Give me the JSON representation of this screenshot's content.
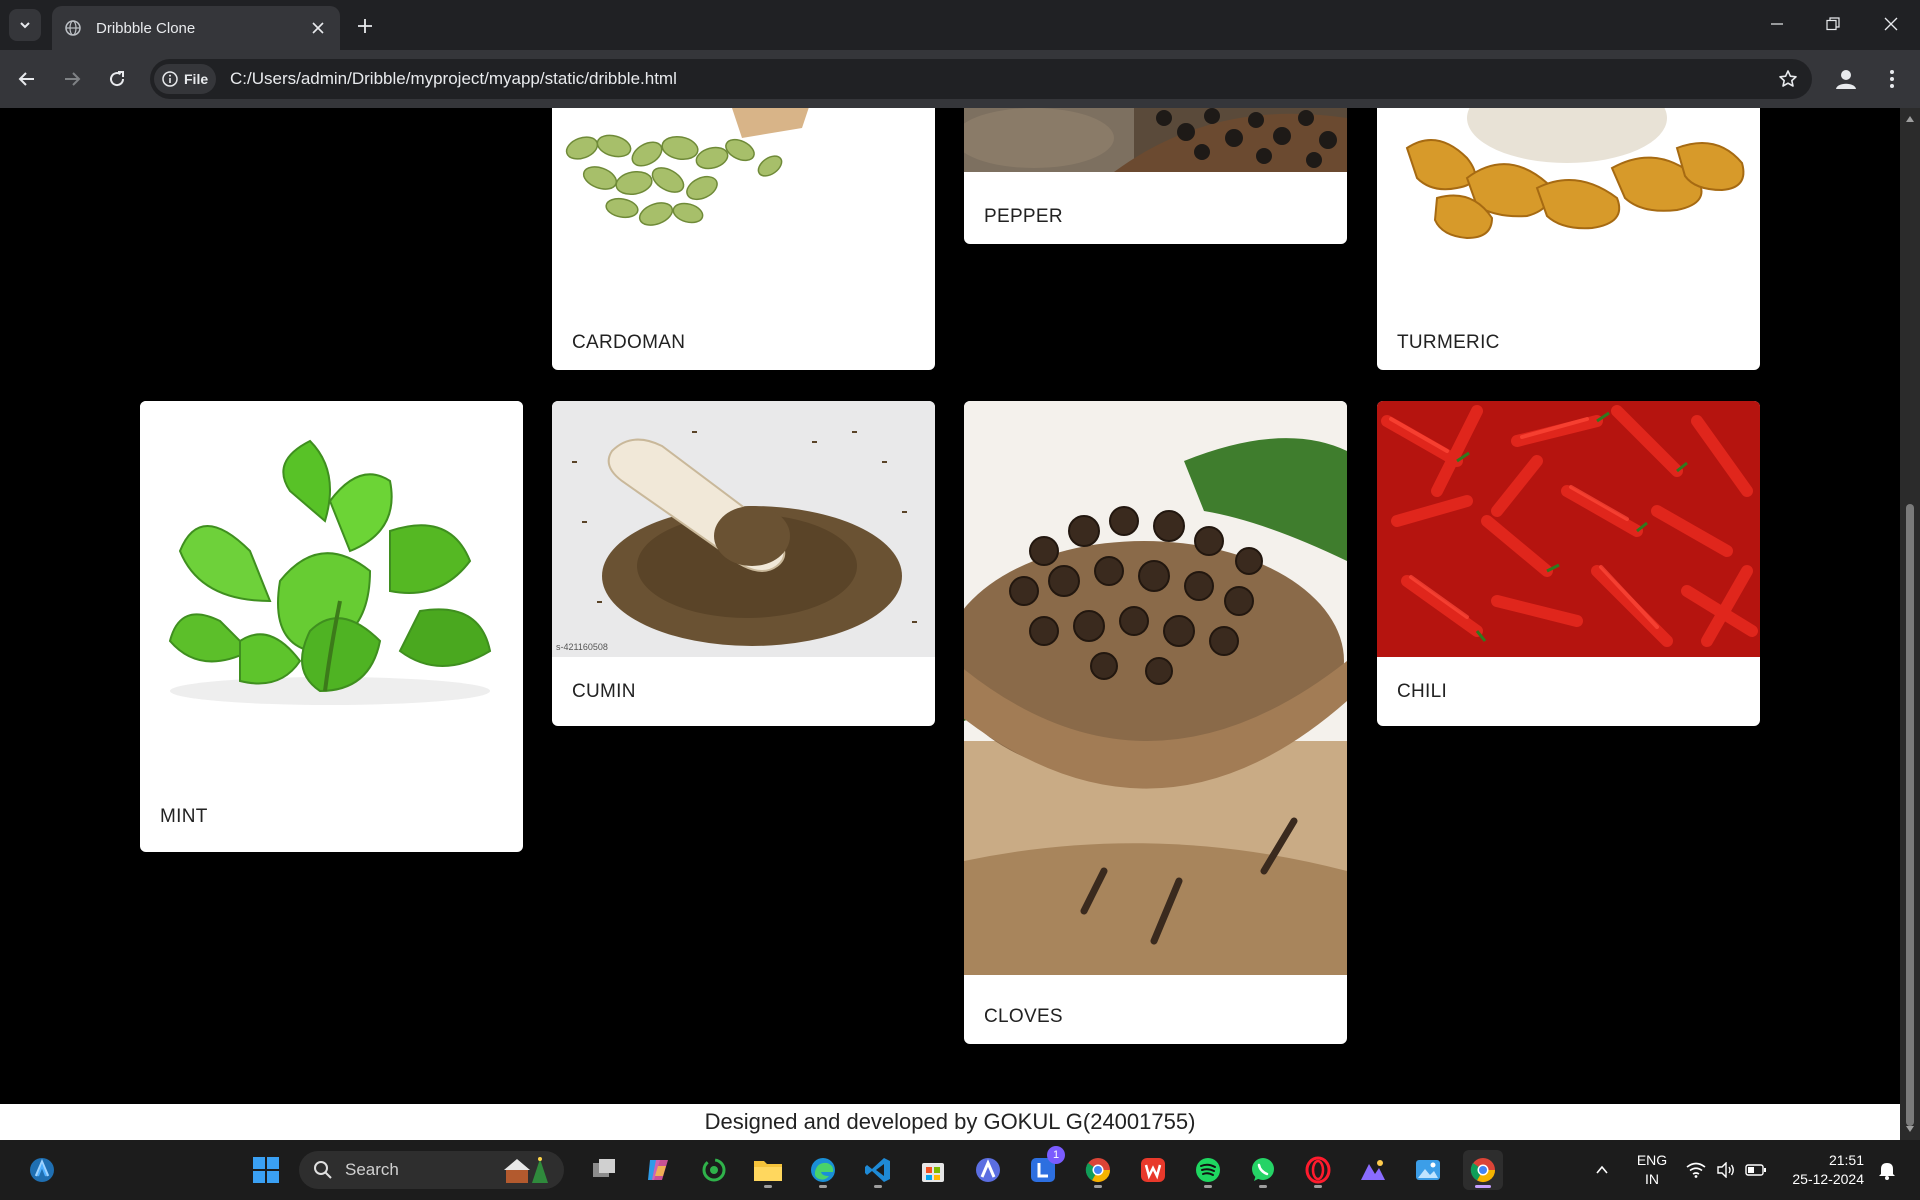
{
  "browser": {
    "tab_title": "Dribbble Clone",
    "site_chip": "File",
    "url": "C:/Users/admin/Dribble/myproject/myapp/static/dribble.html"
  },
  "page": {
    "cards": [
      {
        "label": "CARDOMAN"
      },
      {
        "label": "PEPPER"
      },
      {
        "label": "TURMERIC"
      },
      {
        "label": "MINT"
      },
      {
        "label": "CUMIN"
      },
      {
        "label": "CLOVES"
      },
      {
        "label": "CHILI"
      }
    ],
    "cumin_watermark": "s-421160508",
    "footer": "Designed and developed by GOKUL G(24001755)"
  },
  "taskbar": {
    "search_placeholder": "Search",
    "lang_top": "ENG",
    "lang_bottom": "IN",
    "time": "21:51",
    "date": "25-12-2024",
    "badge_count": "1",
    "tray_icon_names": [
      "chevron-up-icon",
      "wifi-icon",
      "volume-icon",
      "battery-icon",
      "bell-icon"
    ]
  },
  "colors": {
    "page_bg": "#000000",
    "card_bg": "#ffffff",
    "chrome_dark": "#202124",
    "chrome_light": "#35363a"
  }
}
